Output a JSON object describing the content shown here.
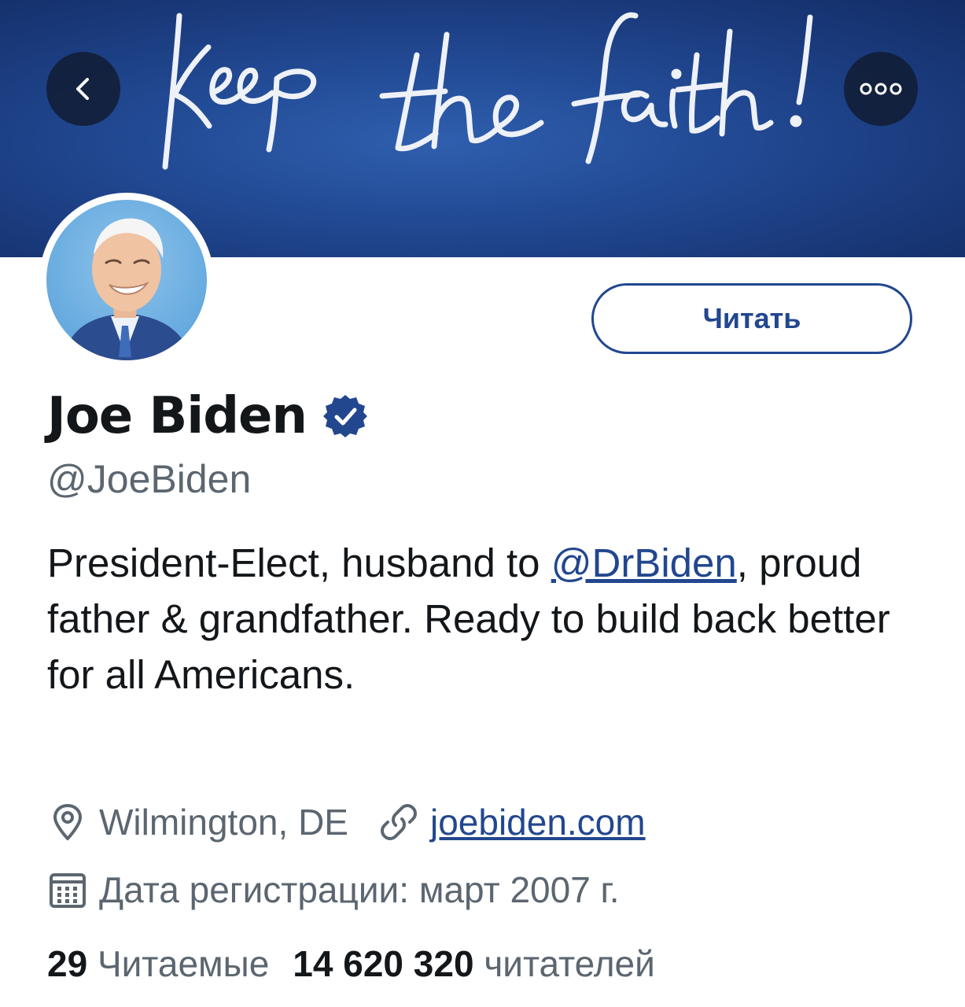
{
  "banner": {
    "script_text": "Keep the faith!",
    "gradient_colors": [
      "#2f5fae",
      "#1a3a7c",
      "#132d66"
    ]
  },
  "nav": {
    "back_icon": "chevron-left-icon",
    "more_icon": "more-dots-icon"
  },
  "profile": {
    "display_name": "Joe Biden",
    "verified_icon": "verified-badge-icon",
    "handle": "@JoeBiden",
    "follow_label": "Читать",
    "bio": {
      "before_mention": "President-Elect, husband to ",
      "mention": "@DrBiden",
      "after_mention": ", proud father & grandfather. Ready to build back better for all Americans."
    },
    "location": "Wilmington, DE",
    "location_icon": "location-pin-icon",
    "website": "joebiden.com",
    "website_icon": "link-icon",
    "joined": "Дата регистрации: март 2007 г.",
    "joined_icon": "calendar-icon",
    "following_count": "29",
    "following_label": "Читаемые",
    "followers_count": "14 620 320",
    "followers_label": "читателей"
  },
  "colors": {
    "accent": "#22478f",
    "text_primary": "#14171a",
    "text_secondary": "#5b6670"
  }
}
